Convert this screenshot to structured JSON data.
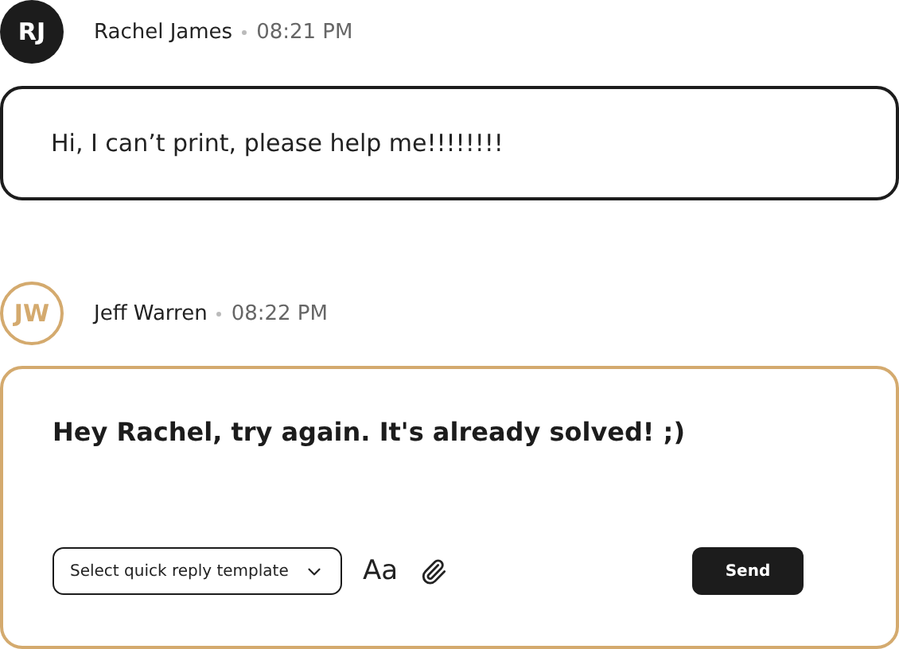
{
  "messages": [
    {
      "kind": "incoming",
      "initials": "RJ",
      "author": "Rachel James",
      "time": "08:21 PM",
      "text": "Hi, I can’t print, please help me!!!!!!!!"
    }
  ],
  "reply": {
    "initials": "JW",
    "author": "Jeff Warren",
    "time": "08:22 PM",
    "value": "Hey Rachel, try again. It's already solved! ;)",
    "template_placeholder": "Select quick reply template",
    "font_button": "Aa",
    "send": "Send"
  }
}
